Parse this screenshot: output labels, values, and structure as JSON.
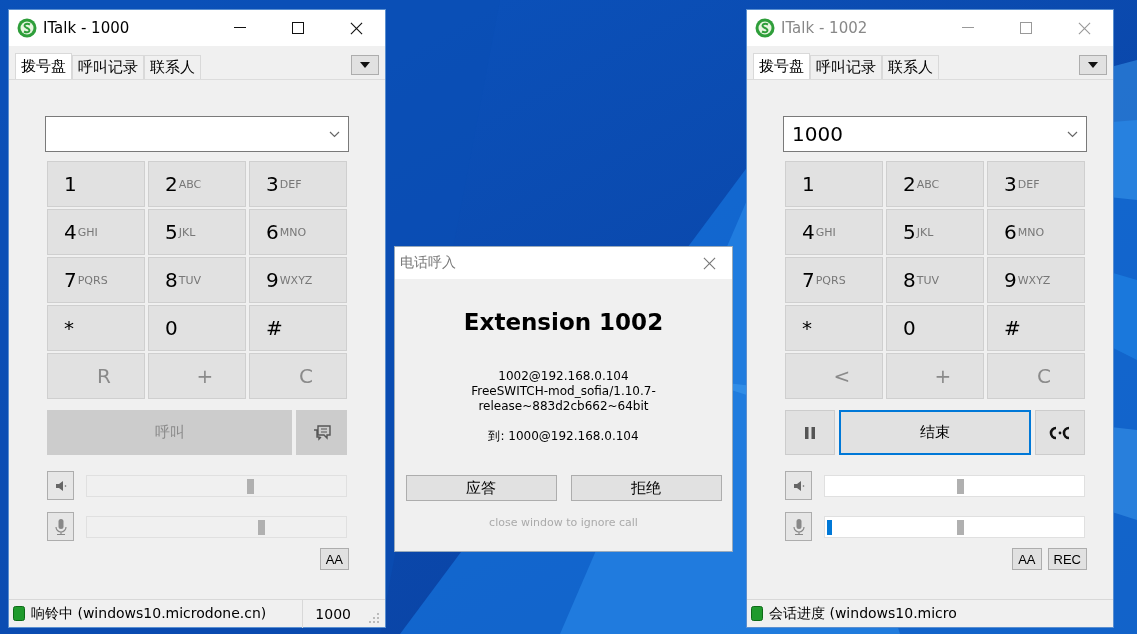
{
  "dialog_windows": [
    {
      "title": "ITalk - 1000",
      "active": true,
      "tabs": [
        {
          "label": "拨号盘",
          "selected": true
        },
        {
          "label": "呼叫记录",
          "selected": false
        },
        {
          "label": "联系人",
          "selected": false
        }
      ],
      "keys": [
        {
          "digit": "1",
          "disabled": false
        },
        {
          "digit": "2",
          "letters": "ABC",
          "disabled": false
        },
        {
          "digit": "3",
          "letters": "DEF",
          "disabled": false
        },
        {
          "digit": "4",
          "letters": "GHI",
          "disabled": false
        },
        {
          "digit": "5",
          "letters": "JKL",
          "disabled": false
        },
        {
          "digit": "6",
          "letters": "MNO",
          "disabled": false
        },
        {
          "digit": "7",
          "letters": "PQRS",
          "disabled": false
        },
        {
          "digit": "8",
          "letters": "TUV",
          "disabled": false
        },
        {
          "digit": "9",
          "letters": "WXYZ",
          "disabled": false
        },
        {
          "digit": "*",
          "disabled": false
        },
        {
          "digit": "0",
          "disabled": false
        },
        {
          "digit": "#",
          "disabled": false
        },
        {
          "digit": "R",
          "disabled": true
        },
        {
          "digit": "+",
          "disabled": true
        },
        {
          "digit": "C",
          "disabled": true
        }
      ],
      "call_controls": [
        {
          "kind": "call",
          "label": "呼叫",
          "disabled": true,
          "focused": false
        },
        {
          "kind": "message",
          "disabled": true,
          "focused": false
        }
      ],
      "speaker": {
        "level": 0.63
      },
      "microphone": {
        "level": 0.67
      },
      "option_buttons": [
        "AA"
      ],
      "status": {
        "text": "响铃中 (windows10.microdone.cn)",
        "number": "1000"
      }
    },
    {
      "title": "ITalk - 1002",
      "active": false,
      "tabs": [
        {
          "label": "拨号盘",
          "selected": true
        },
        {
          "label": "呼叫记录",
          "selected": false
        },
        {
          "label": "联系人",
          "selected": false
        }
      ],
      "dial_field": {
        "value": "1000"
      },
      "keys": [
        {
          "digit": "1",
          "disabled": false
        },
        {
          "digit": "2",
          "letters": "ABC",
          "disabled": false
        },
        {
          "digit": "3",
          "letters": "DEF",
          "disabled": false
        },
        {
          "digit": "4",
          "letters": "GHI",
          "disabled": false
        },
        {
          "digit": "5",
          "letters": "JKL",
          "disabled": false
        },
        {
          "digit": "6",
          "letters": "MNO",
          "disabled": false
        },
        {
          "digit": "7",
          "letters": "PQRS",
          "disabled": false
        },
        {
          "digit": "8",
          "letters": "TUV",
          "disabled": false
        },
        {
          "digit": "9",
          "letters": "WXYZ",
          "disabled": false
        },
        {
          "digit": "*",
          "disabled": false
        },
        {
          "digit": "0",
          "disabled": false
        },
        {
          "digit": "#",
          "disabled": false
        },
        {
          "digit": "<",
          "disabled": true
        },
        {
          "digit": "+",
          "disabled": true
        },
        {
          "digit": "C",
          "disabled": true
        }
      ],
      "call_controls": [
        {
          "kind": "hold",
          "disabled": false,
          "focused": false
        },
        {
          "kind": "hangup",
          "label": "结束",
          "disabled": false,
          "focused": true
        },
        {
          "kind": "transfer",
          "disabled": false,
          "focused": false
        }
      ],
      "speaker": {
        "level": 0.52
      },
      "microphone": {
        "level": 0.52,
        "meter": {
          "level": 0.02
        }
      },
      "option_buttons": [
        "AA",
        "REC"
      ],
      "status": {
        "text": "会话进度 (windows10.micro"
      }
    }
  ],
  "incoming_call": {
    "title": "电话呼入",
    "caller": "Extension 1002",
    "details": [
      "1002@192.168.0.104",
      "FreeSWITCH-mod_sofia/1.10.7-",
      "release~883d2cb662~64bit"
    ],
    "to": "到: 1000@192.168.0.104",
    "buttons": [
      "应答",
      "拒绝"
    ],
    "hint": "close window to ignore call"
  }
}
